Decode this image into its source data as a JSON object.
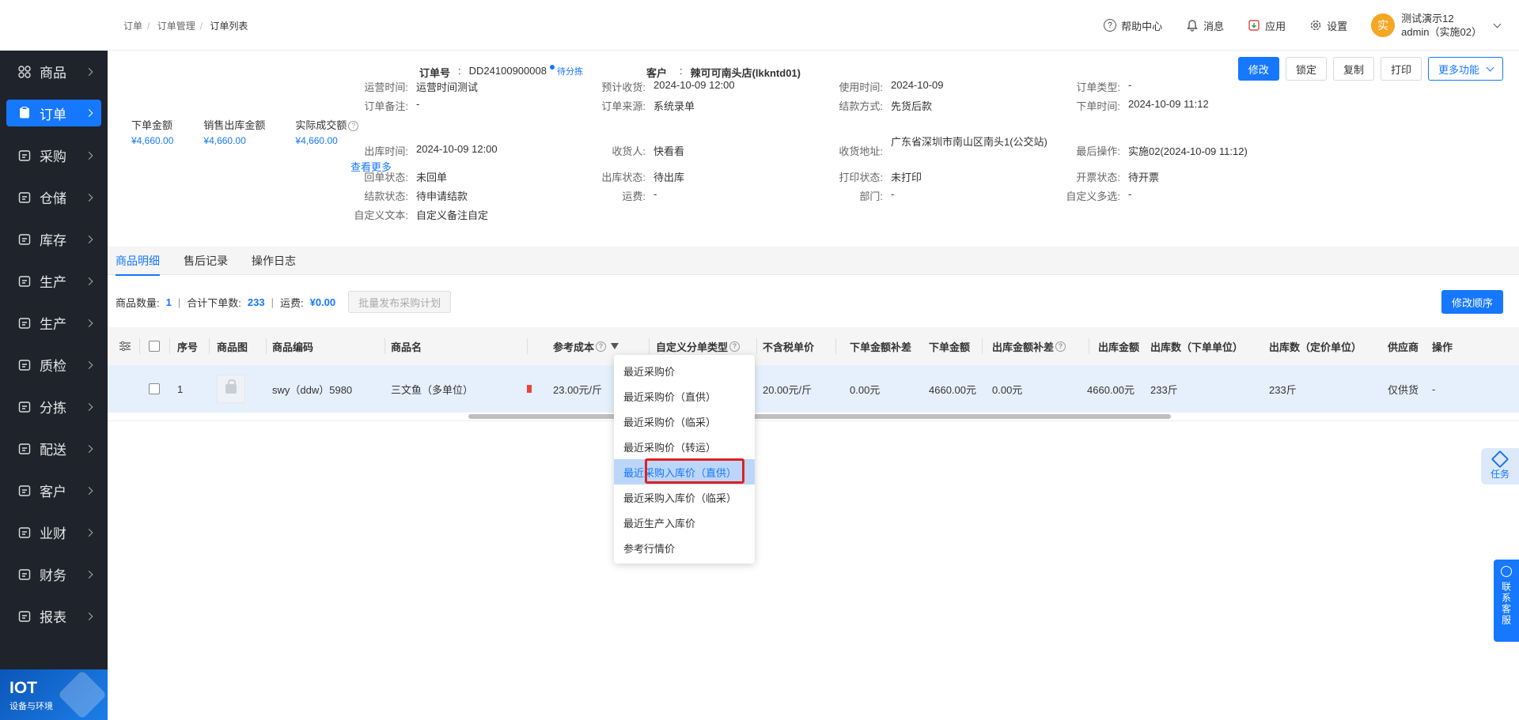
{
  "sidebar": {
    "items": [
      {
        "label": "商品",
        "icon": "grid-icon"
      },
      {
        "label": "订单",
        "icon": "clipboard-icon",
        "active": true
      },
      {
        "label": "采购",
        "icon": "basket-icon"
      },
      {
        "label": "仓储",
        "icon": "warehouse-icon"
      },
      {
        "label": "库存",
        "icon": "inventory-icon"
      },
      {
        "label": "生产",
        "icon": "factory-icon"
      },
      {
        "label": "生产",
        "icon": "factory-icon"
      },
      {
        "label": "质检",
        "icon": "shield-check-icon"
      },
      {
        "label": "分拣",
        "icon": "sort-icon"
      },
      {
        "label": "配送",
        "icon": "truck-icon"
      },
      {
        "label": "客户",
        "icon": "user-icon"
      },
      {
        "label": "业财",
        "icon": "chart-icon"
      },
      {
        "label": "财务",
        "icon": "finance-icon"
      },
      {
        "label": "报表",
        "icon": "report-icon"
      }
    ],
    "iot": {
      "title": "IOT",
      "subtitle": "设备与环境"
    }
  },
  "topbar": {
    "breadcrumb": [
      "订单",
      "订单管理",
      "订单列表"
    ],
    "help": "帮助中心",
    "messages": "消息",
    "apps": "应用",
    "settings": "设置",
    "user": {
      "avatar_char": "实",
      "name": "测试演示12",
      "account": "admin（实施02）"
    }
  },
  "order": {
    "no_label": "订单号",
    "no_value": "DD24100900008",
    "status": "待分拣",
    "customer_label": "客户",
    "customer_value": "辣可可南头店(lkkntd01)",
    "buttons": {
      "edit": "修改",
      "lock": "锁定",
      "copy": "复制",
      "print": "打印",
      "more": "更多功能"
    },
    "amounts": [
      {
        "label": "下单金额",
        "value": "¥4,660.00"
      },
      {
        "label": "销售出库金额",
        "value": "¥4,660.00"
      },
      {
        "label": "实际成交额",
        "value": "¥4,660.00"
      }
    ],
    "view_more": "查看更多",
    "fields": {
      "op_time": {
        "k": "运营时间:",
        "v": "运营时间测试"
      },
      "remark": {
        "k": "订单备注:",
        "v": "-"
      },
      "out_time": {
        "k": "出库时间:",
        "v": "2024-10-09 12:00"
      },
      "return_status": {
        "k": "回单状态:",
        "v": "未回单"
      },
      "settle_status": {
        "k": "结款状态:",
        "v": "待申请结款"
      },
      "custom_text": {
        "k": "自定义文本:",
        "v": "自定义备注自定"
      },
      "expected_receive": {
        "k": "预计收货:",
        "v": "2024-10-09 12:00"
      },
      "source": {
        "k": "订单来源:",
        "v": "系统录单"
      },
      "receiver": {
        "k": "收货人:",
        "v": "快看看"
      },
      "out_status": {
        "k": "出库状态:",
        "v": "待出库"
      },
      "freight": {
        "k": "运费:",
        "v": "-"
      },
      "use_time": {
        "k": "使用时间:",
        "v": "2024-10-09"
      },
      "settle_method": {
        "k": "结款方式:",
        "v": "先货后款"
      },
      "address": {
        "k": "收货地址:",
        "v": "广东省深圳市南山区南头1(公交站)"
      },
      "print_status": {
        "k": "打印状态:",
        "v": "未打印"
      },
      "dept": {
        "k": "部门:",
        "v": "-"
      },
      "order_type": {
        "k": "订单类型:",
        "v": "-"
      },
      "order_time": {
        "k": "下单时间:",
        "v": "2024-10-09 11:12"
      },
      "last_op": {
        "k": "最后操作:",
        "v": "实施02(2024-10-09 11:12)"
      },
      "invoice_status": {
        "k": "开票状态:",
        "v": "待开票"
      },
      "custom_multi": {
        "k": "自定义多选:",
        "v": "-"
      }
    }
  },
  "tabs": [
    "商品明细",
    "售后记录",
    "操作日志"
  ],
  "summary": {
    "count_label": "商品数量:",
    "count": "1",
    "total_label": "合计下单数:",
    "total": "233",
    "freight_label": "运费:",
    "freight": "¥0.00",
    "batch_button": "批量发布采购计划",
    "reorder_button": "修改顺序"
  },
  "table": {
    "headers": {
      "seq": "序号",
      "img": "商品图",
      "code": "商品编码",
      "name": "商品名",
      "ref_cost": "参考成本",
      "custom_type": "自定义分单类型",
      "unit_price": "不含税单价",
      "amount_adj": "下单金额补差",
      "amount": "下单金额",
      "out_amount_adj": "出库金额补差",
      "out_amount": "出库金额",
      "out_qty_order": "出库数（下单单位）",
      "out_qty_price": "出库数（定价单位）",
      "supplier": "供应商",
      "op": "操作"
    },
    "row": {
      "seq": "1",
      "code": "swy（ddw）5980",
      "name": "三文鱼（多单位）",
      "ref_cost": "23.00元/斤",
      "unit_price": "20.00元/斤",
      "amount_adj": "0.00元",
      "amount": "4660.00元",
      "out_amount_adj": "0.00元",
      "out_amount": "4660.00元",
      "out_qty_order": "233斤",
      "out_qty_price": "233斤",
      "supplier": "仅供货",
      "op": "-"
    }
  },
  "ref_cost_menu": [
    "最近采购价",
    "最近采购价（直供）",
    "最近采购价（临采）",
    "最近采购价（转运）",
    "最近采购入库价（直供）",
    "最近采购入库价（临采）",
    "最近生产入库价",
    "参考行情价"
  ],
  "float": {
    "task": "任务",
    "service": "联系客服"
  }
}
